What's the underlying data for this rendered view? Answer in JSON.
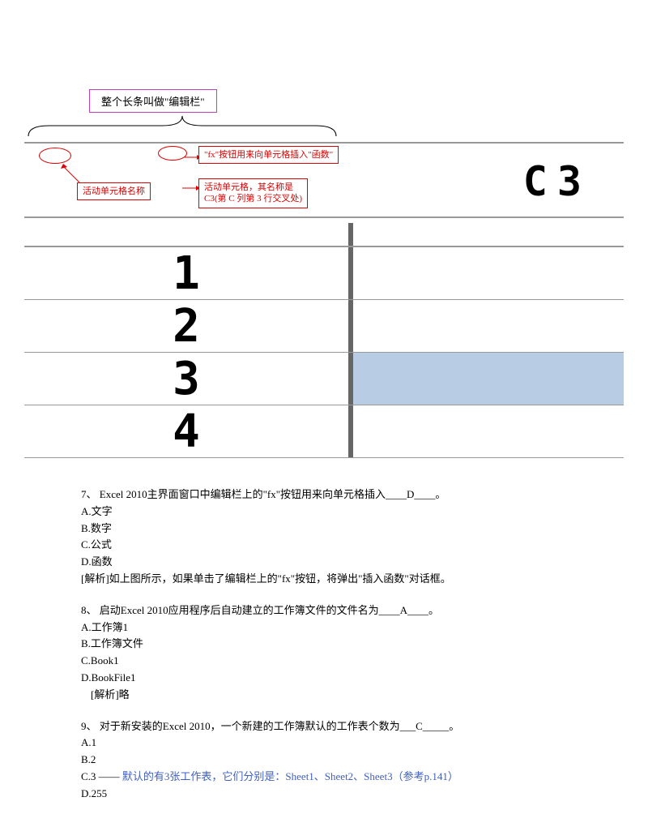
{
  "diagram": {
    "top_label": "整个长条叫做\"编辑栏\"",
    "fx_note": "\"fx\"按钮用来向单元格插入\"函数\"",
    "name_note": "活动单元格名称",
    "active_note_line1": "活动单元格，其名称是",
    "active_note_line2": "C3(第 C 列第 3 行交叉处)",
    "c3": "C3",
    "row1": "1",
    "row2": "2",
    "row3": "3",
    "row4": "4"
  },
  "q7": {
    "stem": "7、 Excel 2010主界面窗口中编辑栏上的\"fx\"按钮用来向单元格插入____D____。",
    "a": "A.文字",
    "b": "B.数字",
    "c": "C.公式",
    "d": "D.函数",
    "expl": "[解析]如上图所示，如果单击了编辑栏上的\"fx\"按钮，将弹出\"插入函数\"对话框。"
  },
  "q8": {
    "stem": "8、 启动Excel 2010应用程序后自动建立的工作簿文件的文件名为____A____。",
    "a": "A.工作簿1",
    "b": "B.工作簿文件",
    "c": "C.Book1",
    "d": "D.BookFile1",
    "expl": "[解析]略"
  },
  "q9": {
    "stem": "9、 对于新安装的Excel 2010，一个新建的工作簿默认的工作表个数为___C_____。",
    "a": "A.1",
    "b": "B.2",
    "c_prefix": "C.3  —— ",
    "c_note": "默认的有3张工作表，它们分别是：Sheet1、Sheet2、Sheet3（参考p.141）",
    "d": "D.255"
  }
}
